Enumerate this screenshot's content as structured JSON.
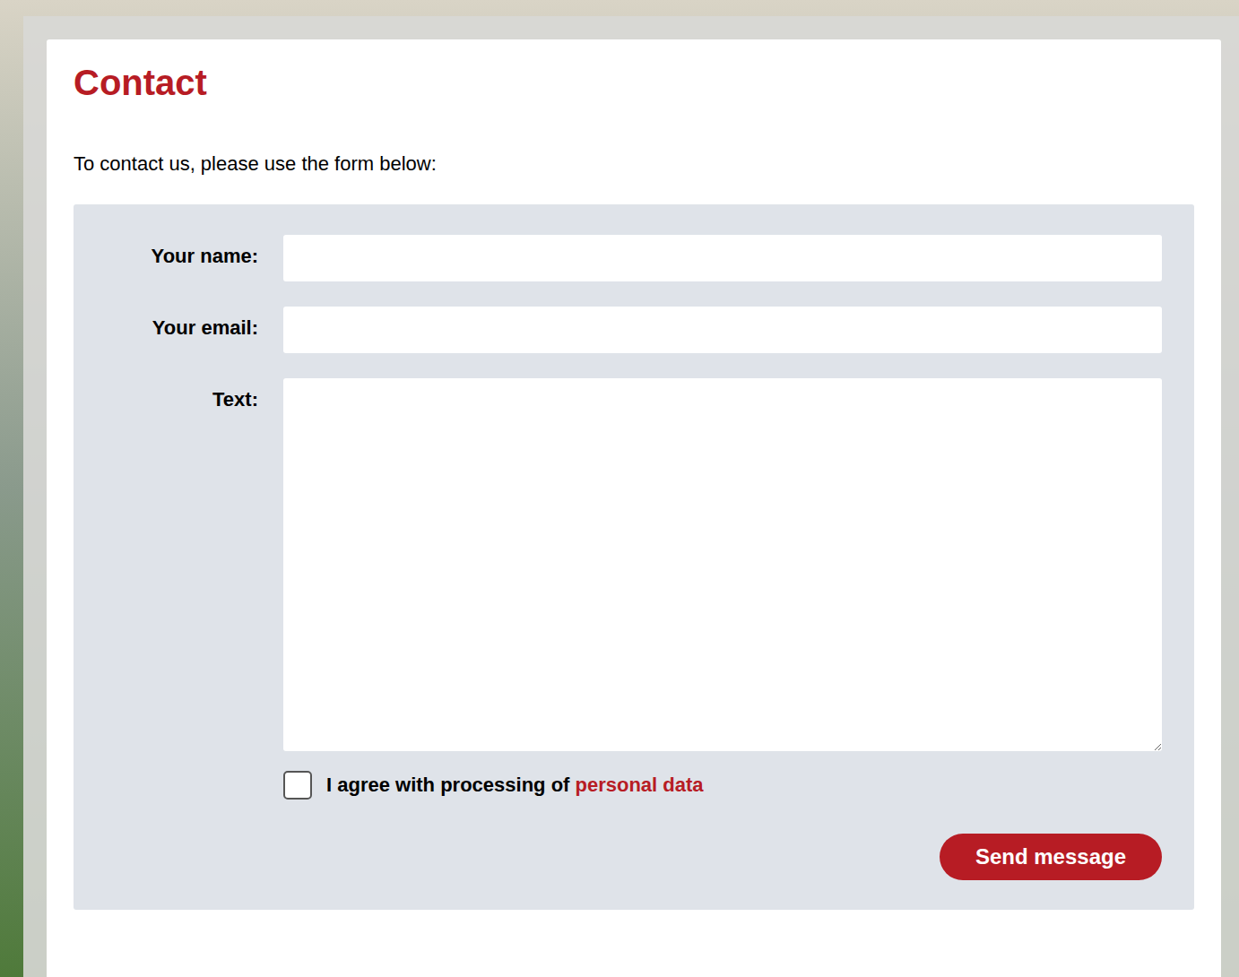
{
  "page": {
    "title": "Contact",
    "intro": "To contact us, please use the form below:"
  },
  "form": {
    "fields": [
      {
        "label": "Your name:",
        "kind": "input",
        "value": ""
      },
      {
        "label": "Your email:",
        "kind": "input",
        "value": ""
      },
      {
        "label": "Text:",
        "kind": "textarea",
        "value": ""
      }
    ],
    "consent": {
      "text": "I agree with processing of ",
      "link": "personal data",
      "checked": false
    },
    "submit": {
      "label": "Send message"
    }
  }
}
